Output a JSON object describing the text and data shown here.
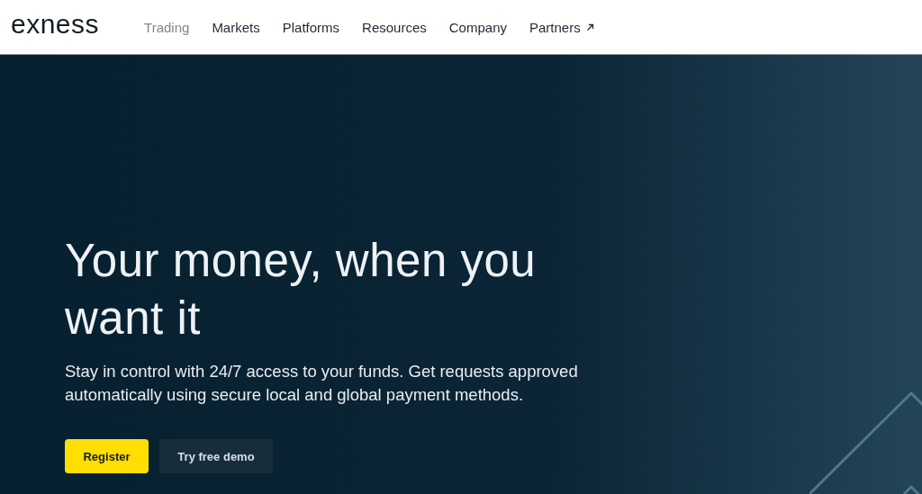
{
  "header": {
    "logo": "exness",
    "nav": [
      {
        "label": "Trading",
        "selected": true,
        "external": false
      },
      {
        "label": "Markets",
        "selected": false,
        "external": false
      },
      {
        "label": "Platforms",
        "selected": false,
        "external": false
      },
      {
        "label": "Resources",
        "selected": false,
        "external": false
      },
      {
        "label": "Company",
        "selected": false,
        "external": false
      },
      {
        "label": "Partners",
        "selected": false,
        "external": true
      }
    ]
  },
  "hero": {
    "title": "Your money, when you want it",
    "subtitle": "Stay in control with 24/7 access to your funds. Get requests approved automatically using secure local and global payment methods.",
    "buttons": [
      {
        "label": "Register",
        "kind": "primary"
      },
      {
        "label": "Try free demo",
        "kind": "secondary"
      }
    ]
  }
}
